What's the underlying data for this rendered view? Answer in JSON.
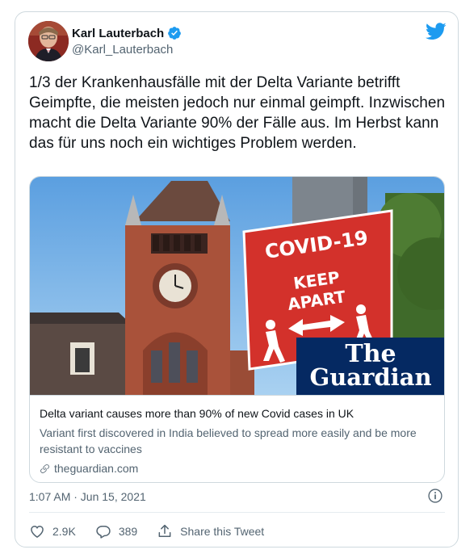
{
  "tweet": {
    "author_name": "Karl Lauterbach",
    "author_handle": "@Karl_Lauterbach",
    "text": "1/3 der Krankenhausfälle mit der Delta Variante betrifft Geimpfte, die meisten jedoch nur einmal geimpft. Inzwischen macht die Delta Variante 90% der Fälle aus. Im Herbst kann das für uns noch ein wichtiges Problem werden.",
    "timestamp": "1:07 AM · Jun 15, 2021"
  },
  "link_card": {
    "image_sign_line1": "COVID-19",
    "image_sign_line2": "KEEP",
    "image_sign_line3": "APART",
    "brand_line1": "The",
    "brand_line2": "Guardian",
    "title": "Delta variant causes more than 90% of new Covid cases in UK",
    "description": "Variant first discovered in India believed to spread more easily and be more resistant to vaccines",
    "domain": "theguardian.com"
  },
  "actions": {
    "like_count": "2.9K",
    "reply_count": "389",
    "share_label": "Share this Tweet"
  },
  "icons": {
    "verified": "verified-badge-icon",
    "twitter": "twitter-bird-icon",
    "info": "info-icon",
    "link": "link-icon",
    "like": "heart-icon",
    "reply": "speech-bubble-icon",
    "share": "share-upload-icon"
  },
  "colors": {
    "twitter_blue": "#1d9bf0",
    "text_primary": "#0f1419",
    "text_secondary": "#536471",
    "border": "#cfd9de",
    "covid_sign_red": "#d3312b",
    "guardian_blue": "#052962"
  }
}
